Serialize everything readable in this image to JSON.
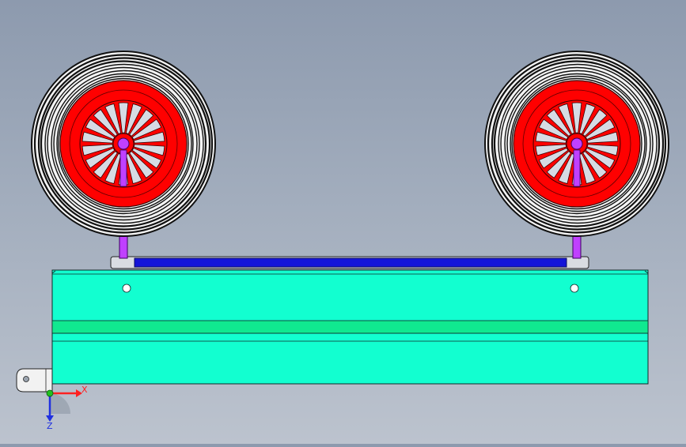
{
  "viewport": {
    "background_top": "#8d9aae",
    "background_bottom": "#bcc3ce"
  },
  "model": {
    "wheel_rim_color": "#ff0000",
    "tire_color": "#111111",
    "hub_strut_color": "#c040ff",
    "axle_bar_color": "#1414d8",
    "body_color": "#12ffd0",
    "stripe_color": "#10e890",
    "bracket_color": "#f2f2f2",
    "wheel_count": 2,
    "spoke_count": 18
  },
  "triad": {
    "x_label": "X",
    "z_label": "Z",
    "x_color": "#ff2020",
    "z_color": "#2030e0",
    "origin_color": "#20c020"
  }
}
